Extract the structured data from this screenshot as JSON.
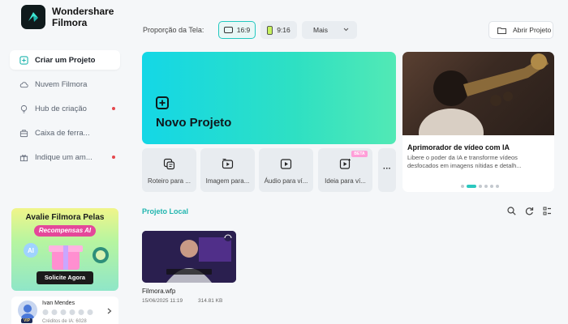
{
  "app": {
    "brand_line1": "Wondershare",
    "brand_line2": "Filmora"
  },
  "sidebar": {
    "items": [
      {
        "label": "Criar um Projeto",
        "icon": "plus-square-icon",
        "active": true,
        "badge": false
      },
      {
        "label": "Nuvem Filmora",
        "icon": "cloud-icon",
        "active": false,
        "badge": false
      },
      {
        "label": "Hub de criação",
        "icon": "bulb-icon",
        "active": false,
        "badge": true
      },
      {
        "label": "Caixa de ferra...",
        "icon": "toolbox-icon",
        "active": false,
        "badge": false
      },
      {
        "label": "Indique um am...",
        "icon": "gift-icon",
        "active": false,
        "badge": true
      }
    ],
    "promo": {
      "title": "Avalie Filmora Pelas",
      "subtitle": "Recompensas AI",
      "button": "Solicite Agora"
    },
    "user": {
      "name": "Ivan Mendes",
      "vip": "VIP",
      "credits": "Créditos de IA: 6028"
    }
  },
  "topbar": {
    "ratio_label": "Proporção da Tela:",
    "ratios": [
      {
        "label": "16:9",
        "selected": true
      },
      {
        "label": "9:16",
        "selected": false
      }
    ],
    "more_label": "Mais",
    "open_project": "Abrir Projeto"
  },
  "hero": {
    "title": "Novo Projeto"
  },
  "tools": [
    {
      "label": "Roteiro para ...",
      "icon": "script-icon",
      "beta": false
    },
    {
      "label": "Imagem para...",
      "icon": "image-to-video-icon",
      "beta": false
    },
    {
      "label": "Áudio para ví...",
      "icon": "audio-to-video-icon",
      "beta": false
    },
    {
      "label": "Ideia para ví...",
      "icon": "idea-to-video-icon",
      "beta": true
    }
  ],
  "beta_label": "BETA",
  "more_tools": "···",
  "banner": {
    "title": "Aprimorador de vídeo com IA",
    "desc": "Libere o poder da IA e transforme vídeos desfocados em imagens nítidas e detalh...",
    "pages": 6,
    "active_page": 2
  },
  "local": {
    "section_title": "Projeto Local",
    "files": [
      {
        "name": "Filmora.wfp",
        "date": "15/06/2025 11:19",
        "size": "314.81 KB"
      }
    ]
  },
  "colors": {
    "accent": "#22c8c0",
    "badge": "#e5484d"
  }
}
